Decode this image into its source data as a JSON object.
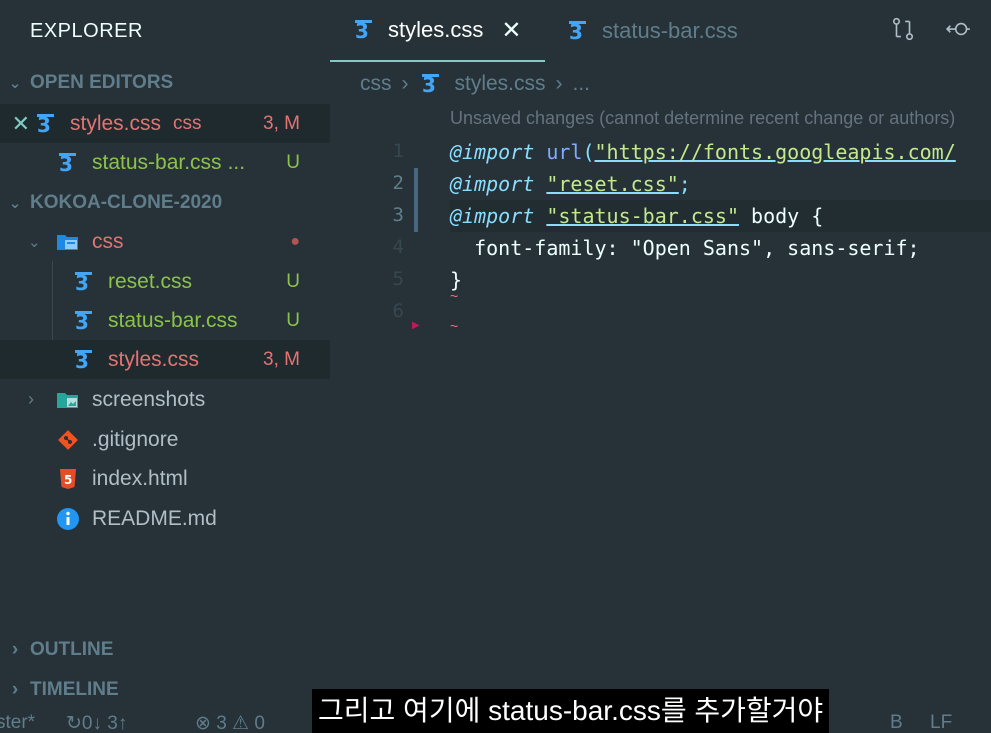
{
  "explorer": {
    "title": "EXPLORER",
    "open_editors_label": "OPEN EDITORS",
    "open_editors": [
      {
        "name": "styles.css",
        "lang": "css",
        "status": "3, M"
      },
      {
        "name": "status-bar.css",
        "ellipsis": "...",
        "status": "U"
      }
    ],
    "project_label": "KOKOA-CLONE-2020",
    "tree": {
      "css_folder": "css",
      "files_in_css": [
        {
          "name": "reset.css",
          "status": "U"
        },
        {
          "name": "status-bar.css",
          "status": "U"
        },
        {
          "name": "styles.css",
          "status": "3, M"
        }
      ],
      "screenshots": "screenshots",
      "gitignore": ".gitignore",
      "index": "index.html",
      "readme": "README.md"
    },
    "outline_label": "OUTLINE",
    "timeline_label": "TIMELINE"
  },
  "tabs": [
    {
      "label": "styles.css",
      "close": "✕"
    },
    {
      "label": "status-bar.css"
    }
  ],
  "breadcrumb": {
    "folder": "css",
    "file": "styles.css",
    "more": "..."
  },
  "editor": {
    "codelens": "Unsaved changes (cannot determine recent change or authors)",
    "line_numbers": [
      "1",
      "2",
      "3",
      "4",
      "5",
      "6"
    ],
    "line1": {
      "kw": "@import",
      "fn": "url",
      "open": "(",
      "str": "\"https://fonts.googleapis.com/"
    },
    "line2": {
      "kw": "@import",
      "str": "\"reset.css\"",
      "semi": ";"
    },
    "line3": {
      "kw": "@import",
      "str": "\"status-bar.css\"",
      "rest": " body {"
    },
    "line4": {
      "text": "  font-family: \"Open Sans\", sans-serif;"
    },
    "line5": {
      "text": "}"
    }
  },
  "statusbar": {
    "branch": "ster*",
    "sync": "↻0↓ 3↑",
    "problems": "⊗ 3 ⚠ 0",
    "encoding": "B",
    "eol": "LF"
  },
  "subtitle": "그리고 여기에 status-bar.css를 추가할거야",
  "colors": {
    "background": "#263238",
    "modified": "#e57373",
    "untracked": "#8bc34a",
    "css_icon": "#42a5f5",
    "accent": "#80cbc4"
  }
}
